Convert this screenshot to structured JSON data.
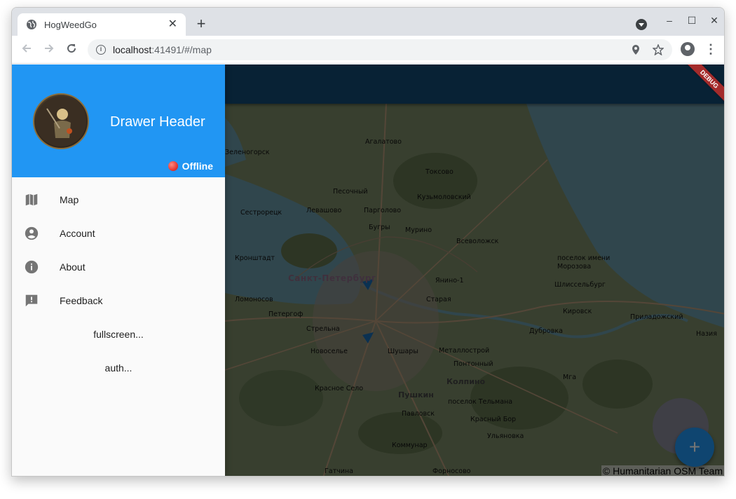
{
  "browser": {
    "tab_title": "HogWeedGo",
    "tab_close": "✕",
    "new_tab": "+",
    "url_host": "localhost",
    "url_rest": ":41491/#/map",
    "window_controls": {
      "minimize": "–",
      "maximize": "☐",
      "close": "✕"
    }
  },
  "drawer": {
    "header_title": "Drawer Header",
    "status_text": "Offline",
    "items": [
      {
        "label": "Map",
        "icon": "map-icon"
      },
      {
        "label": "Account",
        "icon": "account-circle-icon"
      },
      {
        "label": "About",
        "icon": "info-icon"
      },
      {
        "label": "Feedback",
        "icon": "feedback-icon"
      }
    ],
    "buttons": [
      {
        "label": "fullscreen..."
      },
      {
        "label": "auth..."
      }
    ]
  },
  "map": {
    "debug_label": "DEBUG",
    "fab_label": "+",
    "attribution": "© Humanitarian OSM Team",
    "places": [
      "Агалатово",
      "Токсово",
      "Песочный",
      "Кузьмоловский",
      "Сестрорецк",
      "Левашово",
      "Парголово",
      "Бугры",
      "Мурино",
      "Всеволожск",
      "Кронштадт",
      "поселок имени",
      "Морозова",
      "Санкт-Петербург",
      "Янино-1",
      "Шлиссельбург",
      "Ломоносов",
      "Старая",
      "Петергоф",
      "Кировск",
      "Приладожский",
      "Стрельна",
      "Дубровка",
      "Назия",
      "Новоселье",
      "Шушары",
      "Металлострой",
      "Понтонный",
      "Колпино",
      "Мга",
      "Красное Село",
      "Пушкин",
      "поселок Тельмана",
      "Павловск",
      "Красный Бор",
      "Ульяновка",
      "Коммунар",
      "Гатчина",
      "Форносово",
      "Зеленогорск"
    ]
  },
  "colors": {
    "primary": "#2196f3",
    "appbar": "#134a75",
    "status_offline": "#e53935"
  }
}
